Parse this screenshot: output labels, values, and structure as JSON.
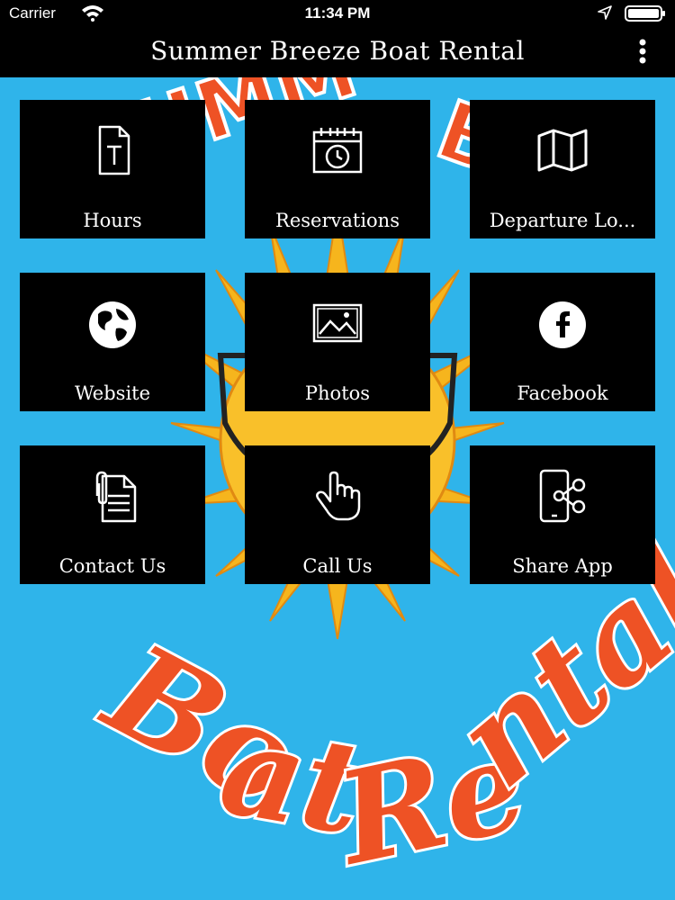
{
  "status_bar": {
    "carrier": "Carrier",
    "time": "11:34 PM",
    "icons": [
      "wifi-icon",
      "location-arrow-icon",
      "battery-icon"
    ]
  },
  "app": {
    "title": "Summer Breeze Boat Rental",
    "menu_icon": "more-vertical-icon"
  },
  "background": {
    "logo_text": "Boat Rental",
    "colors": {
      "sky": "#2fb4ea",
      "sun": "#f6b51d",
      "text": "#ee5225"
    }
  },
  "tiles": [
    {
      "label": "Hours",
      "icon": "text-document-icon"
    },
    {
      "label": "Reservations",
      "icon": "calendar-clock-icon"
    },
    {
      "label": "Departure Lo...",
      "icon": "map-icon"
    },
    {
      "label": "Website",
      "icon": "globe-icon"
    },
    {
      "label": "Photos",
      "icon": "photo-icon"
    },
    {
      "label": "Facebook",
      "icon": "facebook-icon"
    },
    {
      "label": "Contact Us",
      "icon": "document-clip-icon"
    },
    {
      "label": "Call Us",
      "icon": "tap-hand-icon"
    },
    {
      "label": "Share App",
      "icon": "share-phone-icon"
    }
  ],
  "colors": {
    "bar": "#000000",
    "tile": "#000000",
    "accent": "#2fb4ea"
  }
}
